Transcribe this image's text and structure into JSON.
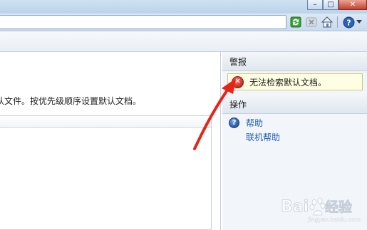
{
  "toolbar": {
    "icons": [
      "refresh-icon",
      "stop-icon",
      "home-icon",
      "help-icon"
    ]
  },
  "main": {
    "description": "认文件。按优先级顺序设置默认文档。"
  },
  "alerts": {
    "header": "警报",
    "message": "无法检索默认文档。"
  },
  "actions": {
    "header": "操作",
    "help_label": "帮助",
    "online_help_label": "联机帮助"
  },
  "watermark": {
    "text": "Bai 经验",
    "subtext": "jingyan.baidu.com"
  },
  "colors": {
    "link": "#1c5fb5",
    "alert_bg": "#fffde2",
    "annotation_arrow": "#e8231a"
  }
}
